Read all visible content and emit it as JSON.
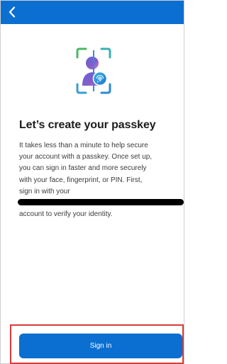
{
  "header": {
    "back_icon": "chevron-left-icon",
    "background_color": "#0a6fd1"
  },
  "hero": {
    "icon": "passkey-person-fingerprint-icon"
  },
  "main": {
    "title": "Let’s create your passkey",
    "description_lines": [
      "It takes less than a minute to help secure",
      "your account with a passkey. Once set up,",
      "you can sign in faster and more securely",
      "with your face, fingerprint, or PIN. First,",
      "sign in with your"
    ],
    "description_tail": "account to verify your identity."
  },
  "footer": {
    "signin_label": "Sign in",
    "button_color": "#0a6fd1",
    "highlight_color": "#d93a3a"
  }
}
